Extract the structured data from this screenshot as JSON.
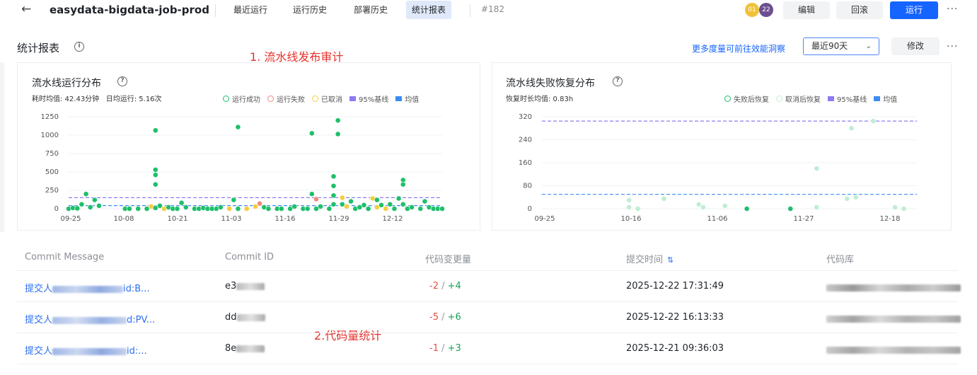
{
  "header": {
    "back_icon": "arrow-left-icon",
    "project": "easydata-bigdata-job-prod",
    "tabs": [
      {
        "label": "最近运行"
      },
      {
        "label": "运行历史"
      },
      {
        "label": "部署历史"
      },
      {
        "label": "统计报表"
      }
    ],
    "run_number": "#182",
    "avatars": [
      {
        "text": "01",
        "color": "#f0c23a"
      },
      {
        "text": "22",
        "color": "#6b4f8e"
      }
    ],
    "buttons": {
      "edit": "编辑",
      "rollback": "回滚",
      "run": "运行"
    },
    "more": "···"
  },
  "section": {
    "title": "统计报表",
    "annotation1": "1. 流水线发布审计",
    "efficiency_link": "更多度量可前往效能洞察",
    "range_select": "最近90天",
    "modify": "修改",
    "more": "···"
  },
  "chart_data": [
    {
      "type": "scatter",
      "title": "流水线运行分布",
      "subtitle_parts": [
        "耗时均值: 42.43分钟",
        "日均运行: 5.16次"
      ],
      "legend": [
        "运行成功",
        "运行失败",
        "已取消",
        "95%基线",
        "均值"
      ],
      "colors": {
        "success": "#1fbf6a",
        "failed": "#f08a7e",
        "cancelled": "#f5cd3f",
        "p95": "#8b7cf2",
        "mean": "#3d8bf2"
      },
      "x_ticks": [
        "09-25",
        "10-08",
        "10-21",
        "11-03",
        "11-16",
        "11-29",
        "12-12"
      ],
      "y_ticks": [
        0,
        250,
        500,
        750,
        1000,
        1250
      ],
      "ylim": [
        0,
        1250
      ],
      "p95": 150,
      "mean": 42,
      "points": [
        {
          "x": 0,
          "y": 0,
          "s": "success"
        },
        {
          "x": 1,
          "y": 10,
          "s": "success"
        },
        {
          "x": 2,
          "y": 5,
          "s": "success"
        },
        {
          "x": 3,
          "y": 60,
          "s": "success"
        },
        {
          "x": 4,
          "y": 200,
          "s": "success"
        },
        {
          "x": 5,
          "y": 20,
          "s": "success"
        },
        {
          "x": 6,
          "y": 120,
          "s": "success"
        },
        {
          "x": 7,
          "y": 40,
          "s": "success"
        },
        {
          "x": 13,
          "y": 0,
          "s": "success"
        },
        {
          "x": 14,
          "y": 0,
          "s": "success"
        },
        {
          "x": 16,
          "y": 0,
          "s": "success"
        },
        {
          "x": 18,
          "y": 0,
          "s": "success"
        },
        {
          "x": 19,
          "y": 30,
          "s": "cancelled"
        },
        {
          "x": 20,
          "y": 1065,
          "s": "success"
        },
        {
          "x": 20,
          "y": 530,
          "s": "success"
        },
        {
          "x": 20,
          "y": 460,
          "s": "success"
        },
        {
          "x": 20,
          "y": 330,
          "s": "success"
        },
        {
          "x": 20,
          "y": 10,
          "s": "success"
        },
        {
          "x": 21,
          "y": 40,
          "s": "success"
        },
        {
          "x": 22,
          "y": 0,
          "s": "cancelled"
        },
        {
          "x": 23,
          "y": 20,
          "s": "success"
        },
        {
          "x": 24,
          "y": 0,
          "s": "success"
        },
        {
          "x": 25,
          "y": 0,
          "s": "success"
        },
        {
          "x": 26,
          "y": 80,
          "s": "success"
        },
        {
          "x": 27,
          "y": 20,
          "s": "success"
        },
        {
          "x": 29,
          "y": 0,
          "s": "success"
        },
        {
          "x": 30,
          "y": 0,
          "s": "success"
        },
        {
          "x": 31,
          "y": 10,
          "s": "success"
        },
        {
          "x": 32,
          "y": 0,
          "s": "success"
        },
        {
          "x": 33,
          "y": 0,
          "s": "success"
        },
        {
          "x": 34,
          "y": 0,
          "s": "success"
        },
        {
          "x": 35,
          "y": 20,
          "s": "success"
        },
        {
          "x": 37,
          "y": 0,
          "s": "cancelled"
        },
        {
          "x": 38,
          "y": 120,
          "s": "success"
        },
        {
          "x": 39,
          "y": 1110,
          "s": "success"
        },
        {
          "x": 39,
          "y": 0,
          "s": "success"
        },
        {
          "x": 41,
          "y": 0,
          "s": "cancelled"
        },
        {
          "x": 43,
          "y": 30,
          "s": "cancelled"
        },
        {
          "x": 44,
          "y": 70,
          "s": "failed"
        },
        {
          "x": 45,
          "y": 20,
          "s": "success"
        },
        {
          "x": 46,
          "y": 0,
          "s": "success"
        },
        {
          "x": 48,
          "y": 0,
          "s": "success"
        },
        {
          "x": 49,
          "y": 0,
          "s": "success"
        },
        {
          "x": 51,
          "y": 0,
          "s": "success"
        },
        {
          "x": 52,
          "y": 30,
          "s": "success"
        },
        {
          "x": 54,
          "y": 0,
          "s": "success"
        },
        {
          "x": 55,
          "y": 0,
          "s": "success"
        },
        {
          "x": 56,
          "y": 1025,
          "s": "success"
        },
        {
          "x": 56,
          "y": 200,
          "s": "success"
        },
        {
          "x": 57,
          "y": 0,
          "s": "success"
        },
        {
          "x": 57,
          "y": 130,
          "s": "failed"
        },
        {
          "x": 58,
          "y": 30,
          "s": "success"
        },
        {
          "x": 60,
          "y": 0,
          "s": "success"
        },
        {
          "x": 61,
          "y": 440,
          "s": "success"
        },
        {
          "x": 61,
          "y": 310,
          "s": "success"
        },
        {
          "x": 61,
          "y": 180,
          "s": "success"
        },
        {
          "x": 61,
          "y": 60,
          "s": "success"
        },
        {
          "x": 62,
          "y": 1200,
          "s": "success"
        },
        {
          "x": 62,
          "y": 1015,
          "s": "success"
        },
        {
          "x": 63,
          "y": 150,
          "s": "cancelled"
        },
        {
          "x": 63,
          "y": 60,
          "s": "success"
        },
        {
          "x": 64,
          "y": 30,
          "s": "cancelled"
        },
        {
          "x": 65,
          "y": 100,
          "s": "success"
        },
        {
          "x": 66,
          "y": 0,
          "s": "success"
        },
        {
          "x": 67,
          "y": 20,
          "s": "success"
        },
        {
          "x": 68,
          "y": 50,
          "s": "success"
        },
        {
          "x": 69,
          "y": 0,
          "s": "success"
        },
        {
          "x": 70,
          "y": 140,
          "s": "cancelled"
        },
        {
          "x": 71,
          "y": 120,
          "s": "success"
        },
        {
          "x": 71,
          "y": 20,
          "s": "cancelled"
        },
        {
          "x": 72,
          "y": 50,
          "s": "success"
        },
        {
          "x": 73,
          "y": 0,
          "s": "cancelled"
        },
        {
          "x": 74,
          "y": 60,
          "s": "success"
        },
        {
          "x": 75,
          "y": 0,
          "s": "success"
        },
        {
          "x": 76,
          "y": 140,
          "s": "success"
        },
        {
          "x": 77,
          "y": 390,
          "s": "success"
        },
        {
          "x": 77,
          "y": 330,
          "s": "success"
        },
        {
          "x": 77,
          "y": 60,
          "s": "success"
        },
        {
          "x": 78,
          "y": 0,
          "s": "success"
        },
        {
          "x": 79,
          "y": 20,
          "s": "success"
        },
        {
          "x": 81,
          "y": 0,
          "s": "success"
        },
        {
          "x": 82,
          "y": 100,
          "s": "success"
        },
        {
          "x": 83,
          "y": 20,
          "s": "success"
        },
        {
          "x": 84,
          "y": 0,
          "s": "success"
        },
        {
          "x": 85,
          "y": 0,
          "s": "success"
        },
        {
          "x": 86,
          "y": 0,
          "s": "success"
        }
      ]
    },
    {
      "type": "scatter",
      "title": "流水线失败恢复分布",
      "subtitle_parts": [
        "恢复时长均值: 0.83h"
      ],
      "legend": [
        "失败后恢复",
        "取消后恢复",
        "95%基线",
        "均值"
      ],
      "colors": {
        "fail_recover": "#1fbf6a",
        "cancel_recover": "#bfeed2",
        "p95": "#8b7cf2",
        "mean": "#3d8bf2"
      },
      "x_ticks": [
        "09-25",
        "10-16",
        "11-06",
        "11-27",
        "12-18"
      ],
      "y_ticks": [
        0,
        80,
        160,
        240,
        320
      ],
      "ylim": [
        0,
        320
      ],
      "p95": 305,
      "mean": 50,
      "points": [
        {
          "x": 20,
          "y": 30,
          "s": "cancel_recover"
        },
        {
          "x": 20,
          "y": 5,
          "s": "cancel_recover"
        },
        {
          "x": 22,
          "y": 0,
          "s": "cancel_recover"
        },
        {
          "x": 28,
          "y": 35,
          "s": "cancel_recover"
        },
        {
          "x": 36,
          "y": 15,
          "s": "cancel_recover"
        },
        {
          "x": 37,
          "y": 5,
          "s": "cancel_recover"
        },
        {
          "x": 42,
          "y": 10,
          "s": "cancel_recover"
        },
        {
          "x": 47,
          "y": 0,
          "s": "fail_recover"
        },
        {
          "x": 57,
          "y": 0,
          "s": "fail_recover"
        },
        {
          "x": 63,
          "y": 140,
          "s": "cancel_recover"
        },
        {
          "x": 63,
          "y": 5,
          "s": "cancel_recover"
        },
        {
          "x": 70,
          "y": 35,
          "s": "cancel_recover"
        },
        {
          "x": 71,
          "y": 280,
          "s": "cancel_recover"
        },
        {
          "x": 72,
          "y": 40,
          "s": "cancel_recover"
        },
        {
          "x": 76,
          "y": 305,
          "s": "cancel_recover"
        },
        {
          "x": 81,
          "y": 5,
          "s": "cancel_recover"
        },
        {
          "x": 83,
          "y": 0,
          "s": "cancel_recover"
        }
      ]
    }
  ],
  "table": {
    "headers": [
      "Commit Message",
      "Commit ID",
      "代码变更量",
      "提交时间",
      "代码库"
    ],
    "sort_icon": "sort-icon",
    "rows": [
      {
        "msg_prefix": "提交人",
        "msg_suffix": "id:B...",
        "id_prefix": "e3",
        "del": "-2",
        "sep": " / ",
        "add": "+4",
        "time": "2025-12-22 17:31:49"
      },
      {
        "msg_prefix": "提交人",
        "msg_suffix": "d:PV...",
        "id_prefix": "dd",
        "del": "-5",
        "sep": " / ",
        "add": "+6",
        "time": "2025-12-22 16:13:33"
      },
      {
        "msg_prefix": "提交人",
        "msg_suffix": "id:...",
        "id_prefix": "8e",
        "del": "-1",
        "sep": " / ",
        "add": "+3",
        "time": "2025-12-21 09:36:03"
      }
    ],
    "annotation2": "2.代码量统计"
  }
}
